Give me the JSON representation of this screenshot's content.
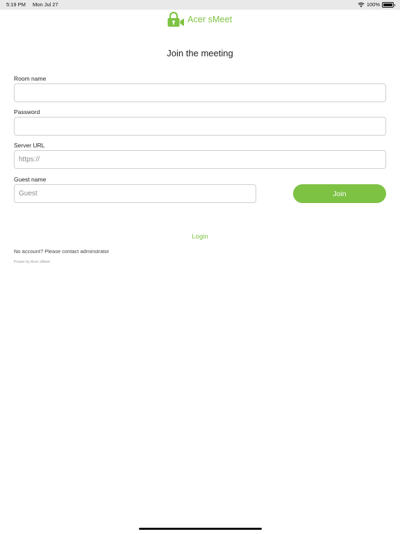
{
  "status_bar": {
    "time": "5:19 PM",
    "date": "Mon Jul 27",
    "battery": "100%",
    "icons": [
      "wifi-icon",
      "battery-icon"
    ]
  },
  "logo": {
    "text": "Acer sMeet",
    "icon": "lock-camera-icon"
  },
  "title": "Join the meeting",
  "form": {
    "room_name": {
      "label": "Room name",
      "value": "",
      "placeholder": ""
    },
    "password": {
      "label": "Password",
      "value": "",
      "placeholder": ""
    },
    "server_url": {
      "label": "Server URL",
      "value": "",
      "placeholder": "https://"
    },
    "guest_name": {
      "label": "Guest name",
      "value": "",
      "placeholder": "Guest"
    },
    "join_label": "Join"
  },
  "login_label": "Login",
  "no_account_text": "No account? Please contact adminstrator",
  "powered_by_text": "Power by Acer sMeet",
  "colors": {
    "accent": "#7dc243",
    "status_bar_bg": "#e9e9e9",
    "field_border": "#cfcfcf",
    "text": "#222222"
  }
}
